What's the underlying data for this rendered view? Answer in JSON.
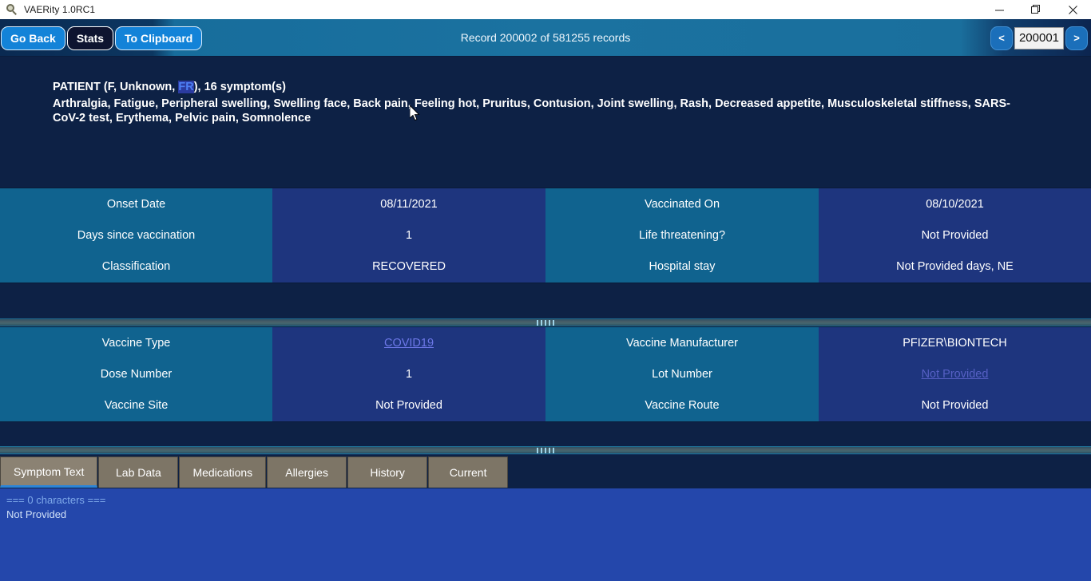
{
  "window": {
    "title": "VAERity 1.0RC1",
    "icon": "magnifier-icon",
    "minimize": "—",
    "maximize": "❐",
    "close": "✕"
  },
  "toolbar": {
    "go_back_label": "Go Back",
    "stats_label": "Stats",
    "to_clipboard_label": "To Clipboard",
    "record_label": "Record 200002 of 581255 records",
    "prev_label": "<",
    "next_label": ">",
    "record_number_value": "200001"
  },
  "patient": {
    "header_prefix": "PATIENT (F, Unknown, ",
    "header_highlight": "FR",
    "header_suffix": "), 16 symptom(s)",
    "symptoms_text": "Arthralgia, Fatigue, Peripheral swelling, Swelling face, Back pain, Feeling hot, Pruritus, Contusion, Joint swelling, Rash, Decreased appetite, Musculoskeletal stiffness, SARS-CoV-2 test, Erythema, Pelvic pain, Somnolence"
  },
  "grid_top": {
    "rows": [
      {
        "label_left": "Onset Date",
        "value_left": "08/11/2021",
        "label_right": "Vaccinated On",
        "value_right": "08/10/2021"
      },
      {
        "label_left": "Days since vaccination",
        "value_left": "1",
        "label_right": "Life threatening?",
        "value_right": "Not Provided"
      },
      {
        "label_left": "Classification",
        "value_left": "RECOVERED",
        "label_right": "Hospital stay",
        "value_right": "Not Provided days, NE"
      }
    ]
  },
  "grid_bottom": {
    "rows": [
      {
        "label_left": "Vaccine Type",
        "value_left": "COVID19",
        "label_right": "Vaccine Manufacturer",
        "value_right": "PFIZER\\BIONTECH"
      },
      {
        "label_left": "Dose Number",
        "value_left": "1",
        "label_right": "Lot Number",
        "value_right": "Not Provided"
      },
      {
        "label_left": "Vaccine Site",
        "value_left": "Not Provided",
        "label_right": "Vaccine Route",
        "value_right": "Not Provided"
      }
    ]
  },
  "tabs": [
    {
      "label": "Symptom Text",
      "active": true
    },
    {
      "label": "Lab Data",
      "active": false
    },
    {
      "label": "Medications",
      "active": false
    },
    {
      "label": "Allergies",
      "active": false
    },
    {
      "label": "History",
      "active": false
    },
    {
      "label": "Current",
      "active": false
    }
  ],
  "text_pane": {
    "char_count_line": "=== 0 characters ===",
    "body": "Not Provided"
  },
  "colors": {
    "accent_blue": "#1383d8",
    "panel_dark": "#0d2145",
    "col_teal": "#10638f",
    "col_navy": "#1e357e",
    "tab_tan": "#7d7566",
    "textpane_blue": "#2447ab",
    "link": "#6d78e8"
  }
}
